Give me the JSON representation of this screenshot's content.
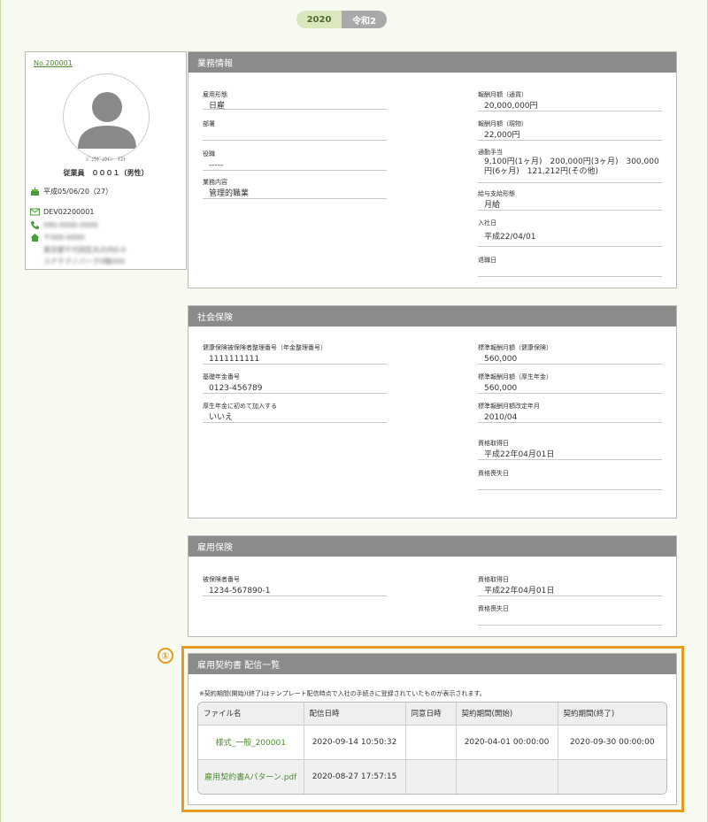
{
  "year_toggle": {
    "western": "2020",
    "japanese": "令和2"
  },
  "profile": {
    "no_prefix": "No.",
    "no": "200001",
    "kana": "ｼﾞｭｳｷﾞｮｳｲﾝ　ﾃｽﾄ",
    "name": "従業員　０００１（男性）",
    "birthday": "平成05/06/20（27）",
    "email": "DEV02200001",
    "phone": "090-0000-0000",
    "postal": "〒000-0000",
    "address1": "東京都千代田区丸の内0-0",
    "address2": "ユナテクノパーク0階000"
  },
  "work": {
    "title": "業務情報",
    "left": [
      {
        "label": "雇用形態",
        "value": "日雇"
      },
      {
        "label": "部署",
        "value": ""
      },
      {
        "label": "役職",
        "value": "-----"
      },
      {
        "label": "業務内容",
        "value": "管理的職業"
      }
    ],
    "right": [
      {
        "label": "報酬月額（通貨）",
        "value": "20,000,000円"
      },
      {
        "label": "報酬月額（現物）",
        "value": "22,000円"
      },
      {
        "label": "通勤手当",
        "value": "9,100円(1ヶ月)　200,000円(3ヶ月)　300,000円(6ヶ月)　121,212円(その他)"
      },
      {
        "label": "給与支給形態",
        "value": "月給"
      },
      {
        "label": "入社日",
        "value": "平成22/04/01"
      },
      {
        "label": "退職日",
        "value": ""
      }
    ]
  },
  "social": {
    "title": "社会保険",
    "left": [
      {
        "label": "健康保険被保険者整理番号（年金整理番号）",
        "value": "1111111111"
      },
      {
        "label": "基礎年金番号",
        "value": "0123-456789"
      },
      {
        "label": "厚生年金に初めて加入する",
        "value": "いいえ"
      }
    ],
    "right": [
      {
        "label": "標準報酬月額（健康保険）",
        "value": "560,000"
      },
      {
        "label": "標準報酬月額（厚生年金）",
        "value": "560,000"
      },
      {
        "label": "標準報酬月額改定年月",
        "value": "2010/04"
      },
      {
        "label": "資格取得日",
        "value": "平成22年04月01日"
      },
      {
        "label": "資格喪失日",
        "value": ""
      }
    ]
  },
  "employment": {
    "title": "雇用保険",
    "left": [
      {
        "label": "被保険者番号",
        "value": "1234-567890-1"
      }
    ],
    "right": [
      {
        "label": "資格取得日",
        "value": "平成22年04月01日"
      },
      {
        "label": "資格喪失日",
        "value": ""
      }
    ]
  },
  "contracts": {
    "marker": "①",
    "title": "雇用契約書 配信一覧",
    "note": "※契約期間(開始)(終了)はテンプレート配信時点で入社の手続きに登録されていたものが表示されます。",
    "columns": [
      "ファイル名",
      "配信日時",
      "同意日時",
      "契約期間(開始)",
      "契約期間(終了)"
    ],
    "rows": [
      [
        "様式_一般_200001",
        "2020-09-14 10:50:32",
        "",
        "2020-04-01 00:00:00",
        "2020-09-30 00:00:00"
      ],
      [
        "雇用契約書Aパターン.pdf",
        "2020-08-27 17:57:15",
        "",
        "",
        ""
      ]
    ]
  },
  "colors": {
    "accent": "#e69a1e",
    "link": "#4c8c2e",
    "header": "#8b8b8b"
  }
}
